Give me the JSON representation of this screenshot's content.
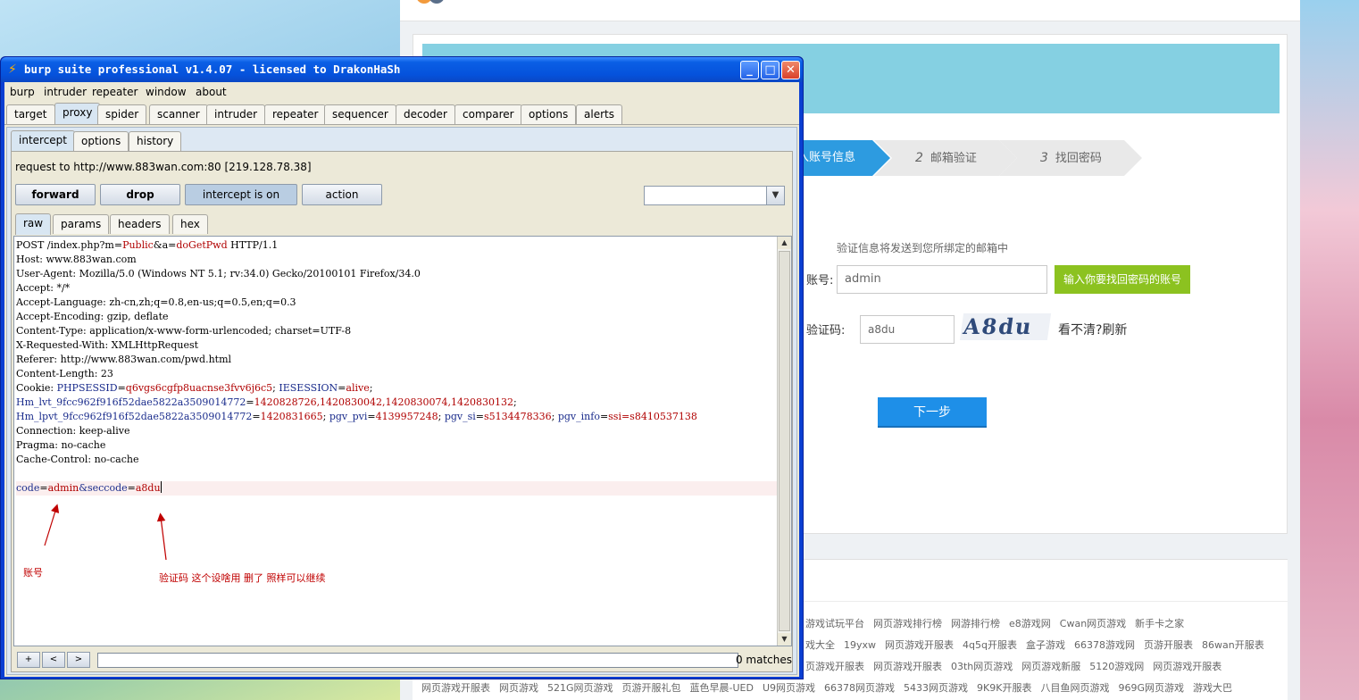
{
  "burp_window": {
    "title": "burp suite professional v1.4.07 - licensed to DrakonHaSh",
    "menu": [
      "burp",
      "intruder",
      "repeater",
      "window",
      "about"
    ],
    "tabs": [
      "target",
      "proxy",
      "spider",
      "scanner",
      "intruder",
      "repeater",
      "sequencer",
      "decoder",
      "comparer",
      "options",
      "alerts"
    ],
    "active_tab": "proxy",
    "proxy_tabs": [
      "intercept",
      "options",
      "history"
    ],
    "active_proxy_tab": "intercept",
    "request_info": "request to http://www.883wan.com:80  [219.128.78.38]",
    "buttons": {
      "forward": "forward",
      "drop": "drop",
      "intercept": "intercept is on",
      "action": "action"
    },
    "view_tabs": [
      "raw",
      "params",
      "headers",
      "hex"
    ],
    "active_view_tab": "raw",
    "request_lines": {
      "l1": "POST /index.php?m=",
      "l1_m": "Public",
      "l1_a_key": "&a=",
      "l1_a": "doGetPwd",
      "l1_rest": " HTTP/1.1",
      "host": "Host: www.883wan.com",
      "ua": "User-Agent: Mozilla/5.0 (Windows NT 5.1; rv:34.0) Gecko/20100101 Firefox/34.0",
      "accept": "Accept: */*",
      "lang": "Accept-Language: zh-cn,zh;q=0.8,en-us;q=0.5,en;q=0.3",
      "enc": "Accept-Encoding: gzip, deflate",
      "ctype": "Content-Type: application/x-www-form-urlencoded; charset=UTF-8",
      "xrw": "X-Requested-With: XMLHttpRequest",
      "referer": "Referer: http://www.883wan.com/pwd.html",
      "clen": "Content-Length: 23",
      "cookie_label": "Cookie: ",
      "cookie_1_name": "PHPSESSID",
      "cookie_1_val": "q6vgs6cgfp8uacnse3fvv6j6c5",
      "cookie_2_name": "IESESSION",
      "cookie_2_val": "alive",
      "cookie_3_name": "Hm_lvt_9fcc962f916f52dae5822a3509014772",
      "cookie_3_val": "1420828726,1420830042,1420830074,1420830132",
      "cookie_4_name": "Hm_lpvt_9fcc962f916f52dae5822a3509014772",
      "cookie_4_val": "1420831665",
      "cookie_5_name": "pgv_pvi",
      "cookie_5_val": "4139957248",
      "cookie_6_name": "pgv_si",
      "cookie_6_val": "s5134478336",
      "cookie_7_name": "pgv_info",
      "cookie_7_val": "ssi=s8410537138",
      "conn": "Connection: keep-alive",
      "pragma": "Pragma: no-cache",
      "cache": "Cache-Control: no-cache",
      "body_code_key": "code",
      "body_code_val": "admin",
      "body_seccode_key": "&seccode",
      "body_seccode_val": "a8du"
    },
    "annotations": {
      "account": "账号",
      "captcha_note": "验证码    这个设啥用  删了  照样可以继续"
    },
    "search": {
      "btn_plus": "+",
      "btn_prev": "<",
      "btn_next": ">",
      "value": "",
      "matches": "0 matches"
    }
  },
  "web_page": {
    "steps": [
      {
        "num": "",
        "label": "入账号信息"
      },
      {
        "num": "2",
        "label": "邮箱验证"
      },
      {
        "num": "3",
        "label": "找回密码"
      }
    ],
    "hint": "验证信息将发送到您所绑定的邮箱中",
    "account_label": "账号:",
    "account_value": "admin",
    "account_tip": "输入你要找回密码的账号",
    "code_label": "验证码:",
    "code_value": "a8du",
    "captcha_text": "A8du",
    "refresh_text": "看不清?刷新",
    "next_button": "下一步",
    "links_row1": [
      "游戏试玩平台",
      "网页游戏排行榜",
      "网游排行榜",
      "e8游戏网",
      "Cwan网页游戏",
      "新手卡之家"
    ],
    "links_row2": [
      "戏大全",
      "19yxw",
      "网页游戏开服表",
      "4q5q开服表",
      "盒子游戏",
      "66378游戏网",
      "页游开服表",
      "86wan开服表"
    ],
    "links_row3": [
      "页游戏开服表",
      "网页游戏开服表",
      "03th网页游戏",
      "网页游戏新服",
      "5120游戏网",
      "网页游戏开服表"
    ],
    "links_row4": [
      "网页游戏开服表",
      "网页游戏",
      "521G网页游戏",
      "页游开服礼包",
      "蓝色早晨-UED",
      "U9网页游戏",
      "66378网页游戏",
      "5433网页游戏",
      "9K9K开服表",
      "八目鱼网页游戏",
      "969G网页游戏",
      "游戏大巴"
    ]
  },
  "colors": {
    "title_bar": "#0552dc",
    "step_active": "#2d9be0",
    "tip_green": "#8cc220",
    "next_blue": "#1e8fe8",
    "annotation_red": "#c00000"
  },
  "icons": [
    "burp-lightning-icon",
    "minimize-icon",
    "maximize-icon",
    "close-icon",
    "dropdown-arrow-icon",
    "scroll-up-icon",
    "scroll-down-icon"
  ]
}
